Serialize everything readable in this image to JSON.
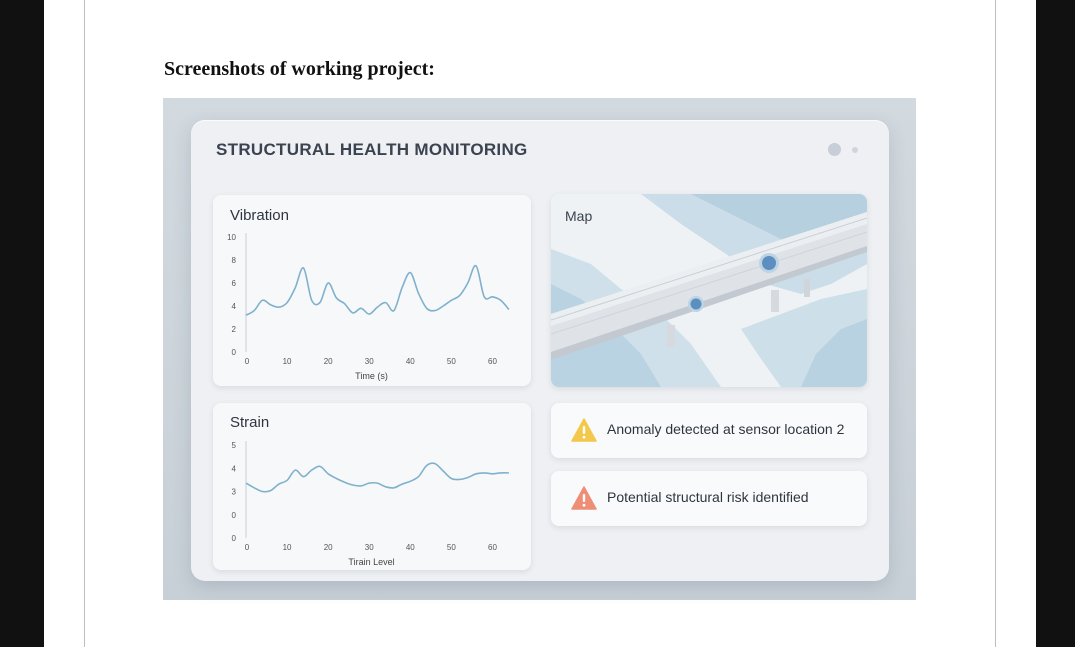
{
  "document": {
    "heading": "Screenshots of working project:"
  },
  "dashboard": {
    "title": "STRUCTURAL HEALTH MONITORING"
  },
  "vibration": {
    "title": "Vibration",
    "x_label": "Time (s)",
    "x_ticks": [
      "0",
      "10",
      "20",
      "30",
      "40",
      "50",
      "60"
    ],
    "y_ticks": [
      "10",
      "8",
      "6",
      "4",
      "2",
      "0"
    ],
    "series_color": "#7fb1cc"
  },
  "strain": {
    "title": "Strain",
    "x_label": "Tirain Level",
    "x_ticks": [
      "0",
      "10",
      "20",
      "30",
      "40",
      "50",
      "60"
    ],
    "y_ticks": [
      "5",
      "4",
      "3",
      "0",
      "0"
    ],
    "series_color": "#7fb1cc"
  },
  "chart_data": [
    {
      "type": "line",
      "title": "Vibration",
      "xlabel": "Time (s)",
      "ylabel": "",
      "xlim": [
        0,
        65
      ],
      "ylim": [
        0,
        10
      ],
      "x": [
        0,
        2,
        4,
        6,
        8,
        10,
        12,
        14,
        16,
        18,
        20,
        22,
        24,
        26,
        28,
        30,
        32,
        34,
        36,
        38,
        40,
        42,
        44,
        46,
        48,
        50,
        52,
        54,
        56,
        58,
        60,
        62,
        64
      ],
      "y": [
        3.2,
        3.6,
        4.5,
        4.1,
        3.9,
        4.3,
        5.6,
        7.3,
        4.5,
        4.3,
        6.0,
        4.7,
        4.2,
        3.4,
        3.8,
        3.3,
        3.9,
        4.3,
        3.6,
        5.6,
        6.9,
        5.1,
        3.8,
        3.6,
        4.0,
        4.5,
        4.9,
        6.0,
        7.5,
        4.8,
        4.8,
        4.5,
        3.7
      ]
    },
    {
      "type": "line",
      "title": "Strain",
      "xlabel": "Tirain Level",
      "ylabel": "",
      "xlim": [
        0,
        65
      ],
      "ylim": [
        0,
        5
      ],
      "x": [
        0,
        2,
        4,
        6,
        8,
        10,
        12,
        14,
        16,
        18,
        20,
        22,
        24,
        26,
        28,
        30,
        32,
        34,
        36,
        38,
        40,
        42,
        44,
        46,
        48,
        50,
        52,
        54,
        56,
        58,
        60,
        62,
        64
      ],
      "y": [
        2.95,
        2.7,
        2.5,
        2.55,
        2.9,
        3.1,
        3.65,
        3.3,
        3.65,
        3.85,
        3.45,
        3.2,
        3.0,
        2.85,
        2.8,
        2.95,
        2.95,
        2.75,
        2.7,
        2.9,
        3.05,
        3.3,
        3.9,
        4.0,
        3.6,
        3.2,
        3.15,
        3.25,
        3.45,
        3.5,
        3.45,
        3.5,
        3.5
      ]
    }
  ],
  "map": {
    "title": "Map",
    "sensors": 2
  },
  "alerts": [
    {
      "text": "Anomaly detected at sensor location 2",
      "icon": "warning-icon",
      "color": "#f3c84b"
    },
    {
      "text": "Potential structural risk identified",
      "icon": "warning-icon",
      "color": "#ef8e76"
    }
  ]
}
